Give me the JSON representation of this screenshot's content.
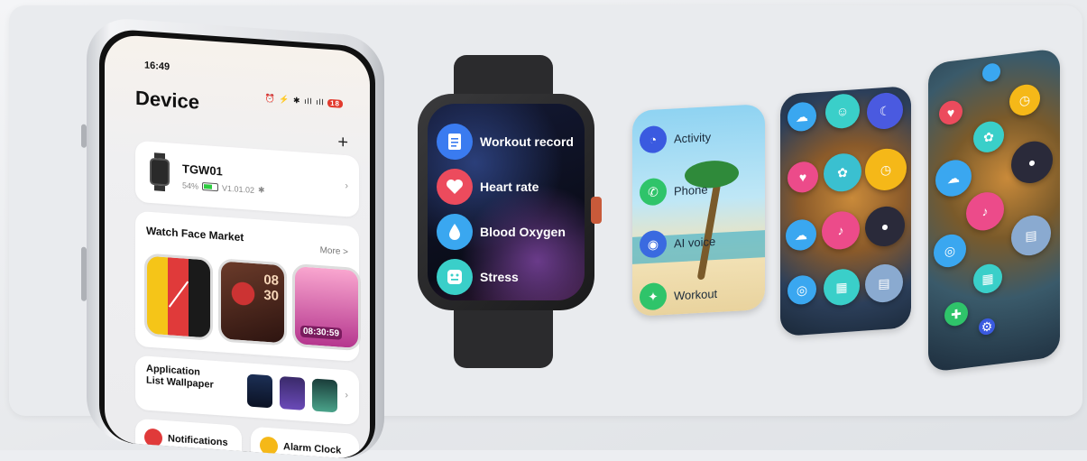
{
  "phone": {
    "status_time": "16:49",
    "status_icons": "⏰ ⚡ ✱ ıll ıll",
    "battery": "18",
    "page_title": "Device",
    "add_label": "+",
    "device": {
      "name": "TGW01",
      "battery": "54%",
      "firmware": "V1.01.02",
      "bt": "✱"
    },
    "watch_face_market": {
      "title": "Watch Face Market",
      "more": "More >",
      "faces": [
        {
          "time": ""
        },
        {
          "time": "08\n30"
        },
        {
          "time": "08:30:59"
        }
      ]
    },
    "app_list": {
      "title": "Application List Wallpaper"
    },
    "tiles": [
      {
        "label": "Notifications",
        "color": "#e03a3a"
      },
      {
        "label": "Alarm Clock",
        "color": "#f5b818"
      }
    ]
  },
  "watch_menu": [
    {
      "label": "Workout record",
      "color": "#3a7bf0",
      "icon": "document-icon"
    },
    {
      "label": "Heart rate",
      "color": "#ec4b5d",
      "icon": "heart-icon"
    },
    {
      "label": "Blood Oxygen",
      "color": "#3aa7f0",
      "icon": "drop-icon"
    },
    {
      "label": "Stress",
      "color": "#3acfc9",
      "icon": "face-icon"
    }
  ],
  "list_screen": [
    {
      "label": "Activity",
      "color": "#3a5ae0",
      "icon": "activity-icon"
    },
    {
      "label": "Phone",
      "color": "#2fc46a",
      "icon": "phone-icon"
    },
    {
      "label": "AI voice",
      "color": "#3a6ae0",
      "icon": "robot-icon"
    },
    {
      "label": "Workout",
      "color": "#2fc46a",
      "icon": "run-icon"
    }
  ],
  "colors": {
    "accent": "#3a7bf0",
    "battery_green": "#2ecc40",
    "battery_red": "#e23b2e"
  }
}
